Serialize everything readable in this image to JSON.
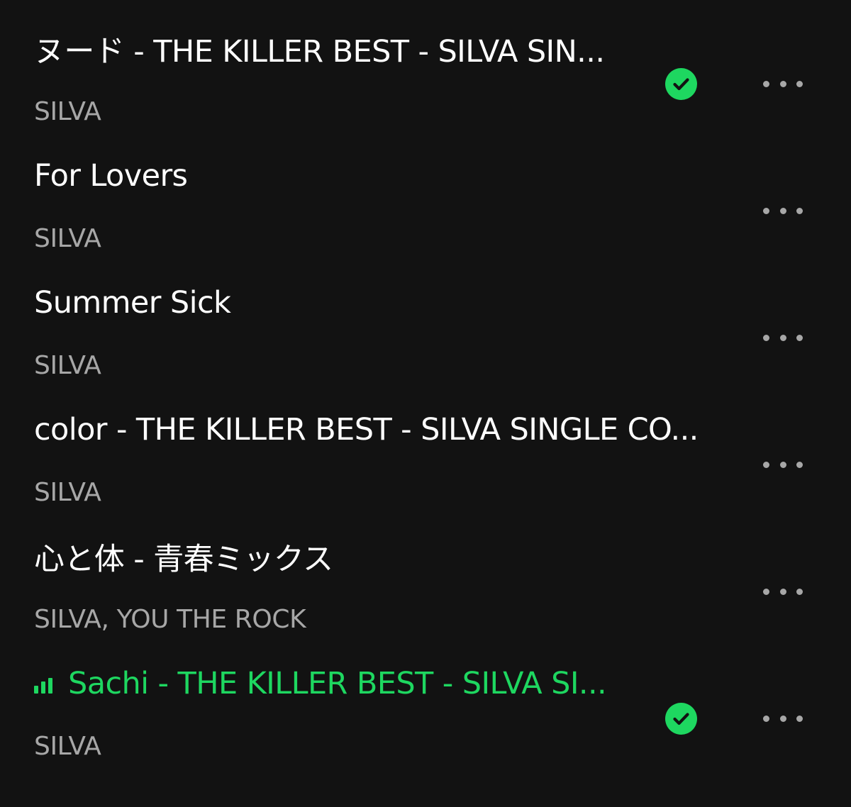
{
  "tracks": [
    {
      "title": "ヌード - THE KILLER BEST - SILVA SIN...",
      "artist": "SILVA",
      "downloaded": true,
      "playing": false
    },
    {
      "title": "For Lovers",
      "artist": "SILVA",
      "downloaded": false,
      "playing": false
    },
    {
      "title": "Summer Sick",
      "artist": "SILVA",
      "downloaded": false,
      "playing": false
    },
    {
      "title": "color - THE KILLER BEST - SILVA SINGLE CO...",
      "artist": "SILVA",
      "downloaded": false,
      "playing": false
    },
    {
      "title": "心と体 - 青春ミックス",
      "artist": "SILVA, YOU THE ROCK",
      "downloaded": false,
      "playing": false
    },
    {
      "title": "Sachi - THE KILLER BEST - SILVA SI...",
      "artist": "SILVA",
      "downloaded": true,
      "playing": true
    }
  ],
  "icons": {
    "downloaded": "check-circle-icon",
    "now_playing": "equalizer-icon",
    "more": "more-horizontal-icon"
  },
  "colors": {
    "background": "#121212",
    "accent": "#1ed760",
    "primary_text": "#ffffff",
    "secondary_text": "#a7a7a7"
  }
}
